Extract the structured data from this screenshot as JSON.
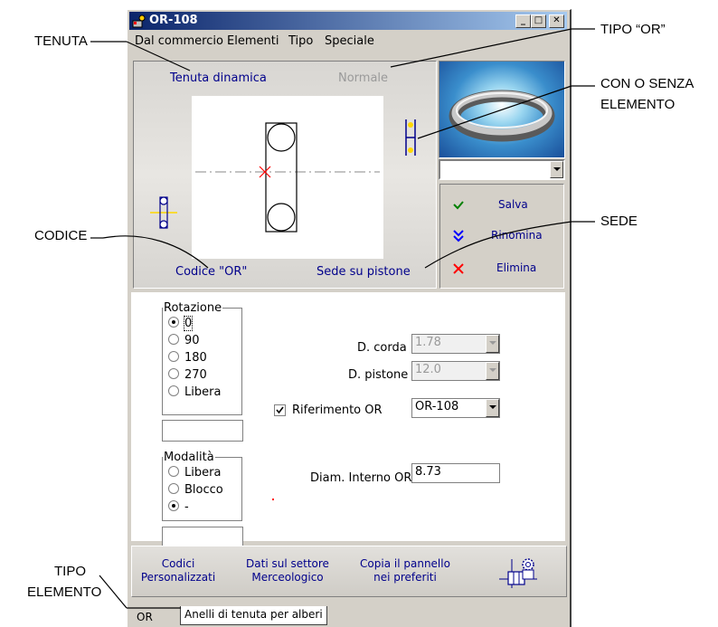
{
  "window": {
    "title": "OR-108",
    "minimize": "_",
    "maximize": "□",
    "close": "✕"
  },
  "menu": [
    "Dal commercio",
    "Elementi",
    "Tipo",
    "Speciale"
  ],
  "drawing": {
    "seal_type": "Tenuta dinamica",
    "or_type": "Normale",
    "code": "Codice \"OR\"",
    "seat": "Sede su pistone"
  },
  "preview_combo": {
    "value": ""
  },
  "actions": [
    {
      "icon": "check-icon",
      "label": "Salva",
      "color": "#008000"
    },
    {
      "icon": "double-chevron-down-icon",
      "label": "Rinomina",
      "color": "#0000ff"
    },
    {
      "icon": "x-icon",
      "label": "Elimina",
      "color": "#ff0000"
    }
  ],
  "rotation": {
    "legend": "Rotazione",
    "options": [
      "0",
      "90",
      "180",
      "270",
      "Libera"
    ],
    "selected": "0",
    "value": ""
  },
  "mode": {
    "legend": "Modalità",
    "options": [
      "Libera",
      "Blocco",
      "-"
    ],
    "selected": "-",
    "value": ""
  },
  "fields": {
    "cord_label": "D. corda",
    "cord_value": "1.78",
    "piston_label": "D. pistone",
    "piston_value": "12.0",
    "ref_label": "Riferimento OR",
    "ref_checked": true,
    "ref_value": "OR-108",
    "inner_label": "Diam. Interno OR",
    "inner_value": "8.73"
  },
  "bottom_links": [
    {
      "line1": "Codici",
      "line2": "Personalizzati"
    },
    {
      "line1": "Dati sul settore",
      "line2": "Merceologico"
    },
    {
      "line1": "Copia il pannello",
      "line2": "nei preferiti"
    }
  ],
  "status": {
    "left": "OR",
    "tab": "Anelli di tenuta per alberi"
  },
  "annotations": {
    "tenuta": "TENUTA",
    "codice": "CODICE",
    "tipo_elemento_1": "TIPO",
    "tipo_elemento_2": "ELEMENTO",
    "tipo_or": "TIPO “OR”",
    "con_senza_1": "CON O SENZA",
    "con_senza_2": "ELEMENTO",
    "sede": "SEDE"
  }
}
